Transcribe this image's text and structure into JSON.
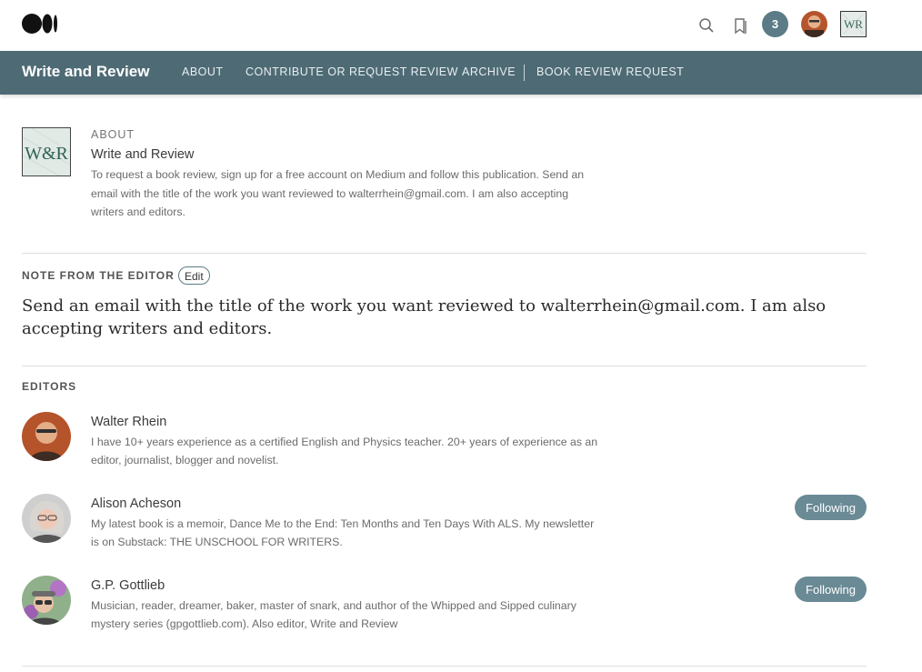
{
  "topbar": {
    "notification_count": "3",
    "pub_monogram": "WR"
  },
  "nav": {
    "title": "Write and Review",
    "links": [
      "ABOUT",
      "CONTRIBUTE OR REQUEST REVIEW",
      "ARCHIVE",
      "BOOK REVIEW REQUEST"
    ]
  },
  "about": {
    "label": "ABOUT",
    "title": "Write and Review",
    "description": "To request a book review, sign up for a free account on Medium and follow this publication. Send an email with the title of the work you want reviewed to walterrhein@gmail.com. I am also accepting writers and editors.",
    "logo_monogram": "W&R"
  },
  "note": {
    "label": "NOTE FROM THE EDITOR",
    "edit_label": "Edit",
    "text": "Send an email with the title of the work you want reviewed to walterrhein@gmail.com. I am also accepting writers and editors."
  },
  "editors": {
    "label": "EDITORS",
    "list": [
      {
        "name": "Walter Rhein",
        "bio": "I have 10+ years experience as a certified English and Physics teacher. 20+ years of experience as an editor, journalist, blogger and novelist.",
        "button": ""
      },
      {
        "name": "Alison Acheson",
        "bio": "My latest book is a memoir, Dance Me to the End: Ten Months and Ten Days With ALS. My newsletter is on Substack: THE UNSCHOOL FOR WRITERS.",
        "button": "Following"
      },
      {
        "name": "G.P. Gottlieb",
        "bio": "Musician, reader, dreamer, baker, master of snark, and author of the Whipped and Sipped culinary mystery series (gpgottlieb.com). Also editor, Write and Review",
        "button": "Following"
      }
    ]
  },
  "colors": {
    "nav_bg": "#4e6b75",
    "accent": "#6a8a95"
  }
}
